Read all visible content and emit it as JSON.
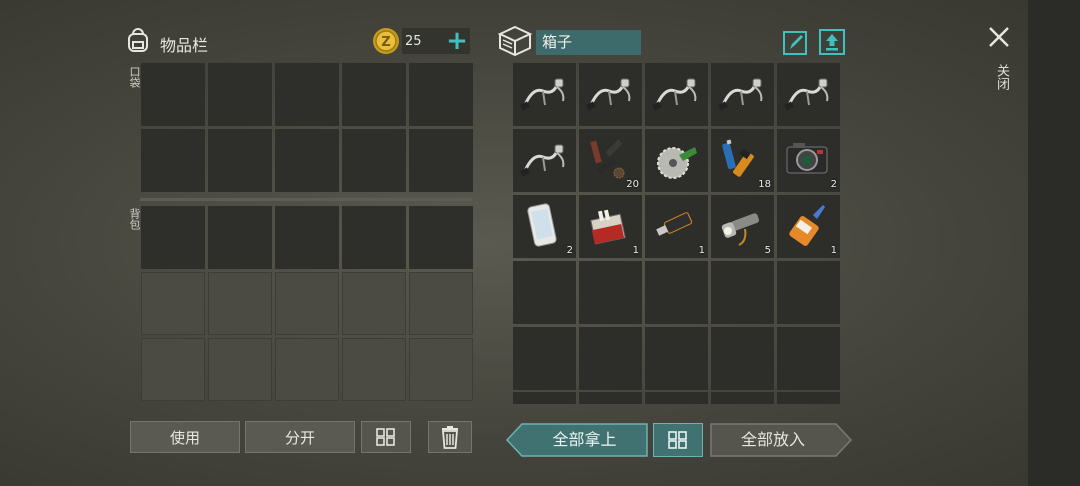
{
  "inventory": {
    "title": "物品栏",
    "coins": "25",
    "pocket_label": "口袋",
    "backpack_label": "背包"
  },
  "container": {
    "title": "箱子",
    "items": [
      {
        "icon": "bike-handlebar-icon",
        "qty": ""
      },
      {
        "icon": "bike-handlebar-icon",
        "qty": ""
      },
      {
        "icon": "bike-handlebar-icon",
        "qty": ""
      },
      {
        "icon": "bike-handlebar-icon",
        "qty": ""
      },
      {
        "icon": "bike-handlebar-icon",
        "qty": ""
      },
      {
        "icon": "bike-handlebar-icon",
        "qty": ""
      },
      {
        "icon": "gun-parts-icon",
        "qty": "20"
      },
      {
        "icon": "saw-blade-icon",
        "qty": ""
      },
      {
        "icon": "batteries-icon",
        "qty": "18"
      },
      {
        "icon": "camera-icon",
        "qty": "2"
      },
      {
        "icon": "smartphone-icon",
        "qty": "2"
      },
      {
        "icon": "cigarette-pack-icon",
        "qty": "1"
      },
      {
        "icon": "usb-drive-icon",
        "qty": "1"
      },
      {
        "icon": "flashlight-icon",
        "qty": "5"
      },
      {
        "icon": "glue-tube-icon",
        "qty": "1"
      }
    ]
  },
  "buttons": {
    "use": "使用",
    "split": "分开",
    "take_all": "全部拿上",
    "put_all": "全部放入"
  },
  "close_label": "关闭",
  "colors": {
    "accent": "#3fc1c0",
    "box_title_bg": "#3d6a6a",
    "take_all_bg": "#3f7271"
  }
}
